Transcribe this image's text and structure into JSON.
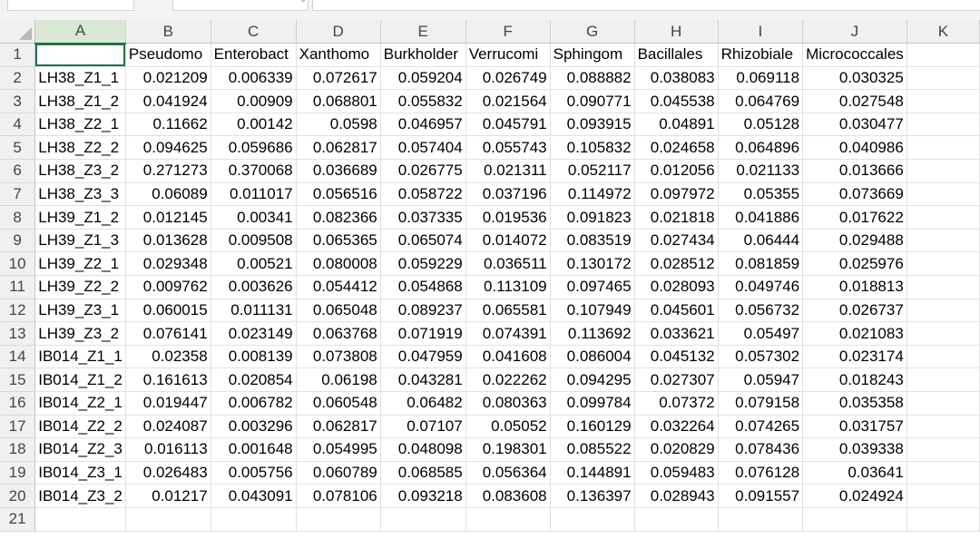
{
  "columns": [
    "A",
    "B",
    "C",
    "D",
    "E",
    "F",
    "G",
    "H",
    "I",
    "J",
    "K"
  ],
  "row_numbers": [
    "1",
    "2",
    "3",
    "4",
    "5",
    "6",
    "7",
    "8",
    "9",
    "10",
    "11",
    "12",
    "13",
    "14",
    "15",
    "16",
    "17",
    "18",
    "19",
    "20",
    "21"
  ],
  "header_row": [
    "",
    "Pseudomo",
    "Enterobact",
    "Xanthomo",
    "Burkholder",
    "Verrucomi",
    "Sphingom",
    "Bacillales",
    "Rhizobiale",
    "Micrococcales",
    ""
  ],
  "rows": [
    [
      "LH38_Z1_1",
      "0.021209",
      "0.006339",
      "0.072617",
      "0.059204",
      "0.026749",
      "0.088882",
      "0.038083",
      "0.069118",
      "0.030325",
      ""
    ],
    [
      "LH38_Z1_2",
      "0.041924",
      "0.00909",
      "0.068801",
      "0.055832",
      "0.021564",
      "0.090771",
      "0.045538",
      "0.064769",
      "0.027548",
      ""
    ],
    [
      "LH38_Z2_1",
      "0.11662",
      "0.00142",
      "0.0598",
      "0.046957",
      "0.045791",
      "0.093915",
      "0.04891",
      "0.05128",
      "0.030477",
      ""
    ],
    [
      "LH38_Z2_2",
      "0.094625",
      "0.059686",
      "0.062817",
      "0.057404",
      "0.055743",
      "0.105832",
      "0.024658",
      "0.064896",
      "0.040986",
      ""
    ],
    [
      "LH38_Z3_2",
      "0.271273",
      "0.370068",
      "0.036689",
      "0.026775",
      "0.021311",
      "0.052117",
      "0.012056",
      "0.021133",
      "0.013666",
      ""
    ],
    [
      "LH38_Z3_3",
      "0.06089",
      "0.011017",
      "0.056516",
      "0.058722",
      "0.037196",
      "0.114972",
      "0.097972",
      "0.05355",
      "0.073669",
      ""
    ],
    [
      "LH39_Z1_2",
      "0.012145",
      "0.00341",
      "0.082366",
      "0.037335",
      "0.019536",
      "0.091823",
      "0.021818",
      "0.041886",
      "0.017622",
      ""
    ],
    [
      "LH39_Z1_3",
      "0.013628",
      "0.009508",
      "0.065365",
      "0.065074",
      "0.014072",
      "0.083519",
      "0.027434",
      "0.06444",
      "0.029488",
      ""
    ],
    [
      "LH39_Z2_1",
      "0.029348",
      "0.00521",
      "0.080008",
      "0.059229",
      "0.036511",
      "0.130172",
      "0.028512",
      "0.081859",
      "0.025976",
      ""
    ],
    [
      "LH39_Z2_2",
      "0.009762",
      "0.003626",
      "0.054412",
      "0.054868",
      "0.113109",
      "0.097465",
      "0.028093",
      "0.049746",
      "0.018813",
      ""
    ],
    [
      "LH39_Z3_1",
      "0.060015",
      "0.011131",
      "0.065048",
      "0.089237",
      "0.065581",
      "0.107949",
      "0.045601",
      "0.056732",
      "0.026737",
      ""
    ],
    [
      "LH39_Z3_2",
      "0.076141",
      "0.023149",
      "0.063768",
      "0.071919",
      "0.074391",
      "0.113692",
      "0.033621",
      "0.05497",
      "0.021083",
      ""
    ],
    [
      "IB014_Z1_1",
      "0.02358",
      "0.008139",
      "0.073808",
      "0.047959",
      "0.041608",
      "0.086004",
      "0.045132",
      "0.057302",
      "0.023174",
      ""
    ],
    [
      "IB014_Z1_2",
      "0.161613",
      "0.020854",
      "0.06198",
      "0.043281",
      "0.022262",
      "0.094295",
      "0.027307",
      "0.05947",
      "0.018243",
      ""
    ],
    [
      "IB014_Z2_1",
      "0.019447",
      "0.006782",
      "0.060548",
      "0.06482",
      "0.080363",
      "0.099784",
      "0.07372",
      "0.079158",
      "0.035358",
      ""
    ],
    [
      "IB014_Z2_2",
      "0.024087",
      "0.003296",
      "0.062817",
      "0.07107",
      "0.05052",
      "0.160129",
      "0.032264",
      "0.074265",
      "0.031757",
      ""
    ],
    [
      "IB014_Z2_3",
      "0.016113",
      "0.001648",
      "0.054995",
      "0.048098",
      "0.198301",
      "0.085522",
      "0.020829",
      "0.078436",
      "0.039338",
      ""
    ],
    [
      "IB014_Z3_1",
      "0.026483",
      "0.005756",
      "0.060789",
      "0.068585",
      "0.056364",
      "0.144891",
      "0.059483",
      "0.076128",
      "0.03641",
      ""
    ],
    [
      "IB014_Z3_2",
      "0.01217",
      "0.043091",
      "0.078106",
      "0.093218",
      "0.083608",
      "0.136397",
      "0.028943",
      "0.091557",
      "0.024924",
      ""
    ],
    [
      "",
      "",
      "",
      "",
      "",
      "",
      "",
      "",
      "",
      "",
      ""
    ]
  ],
  "selected_cell": "A1",
  "colors": {
    "accent": "#217346",
    "header_bg": "#f0f0f0",
    "gridline": "#e1e1e1"
  }
}
